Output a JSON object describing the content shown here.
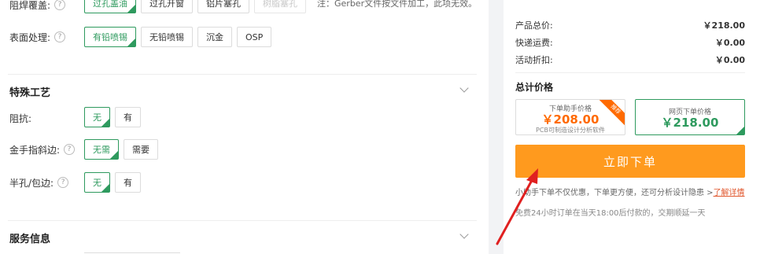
{
  "solder_mask": {
    "label": "阻焊覆盖:",
    "options": [
      "过孔盖油",
      "过孔开窗",
      "铝片塞孔",
      "树脂塞孔"
    ],
    "note": "注：Gerber文件按文件加工，此项无效。"
  },
  "surface": {
    "label": "表面处理:",
    "options": [
      "有铅喷锡",
      "无铅喷锡",
      "沉金",
      "OSP"
    ]
  },
  "special": {
    "title": "特殊工艺",
    "impedance": {
      "label": "阻抗:",
      "options": [
        "无",
        "有"
      ]
    },
    "gold_finger": {
      "label": "金手指斜边:",
      "options": [
        "无需",
        "需要"
      ]
    },
    "half_hole": {
      "label": "半孔/包边:",
      "options": [
        "无",
        "有"
      ]
    }
  },
  "service": {
    "title": "服务信息"
  },
  "prices": [
    {
      "label": "产品总价:",
      "value": "￥218.00"
    },
    {
      "label": "快递运费:",
      "value": "￥0.00"
    },
    {
      "label": "活动折扣:",
      "value": "￥0.00"
    }
  ],
  "total": {
    "title": "总计价格",
    "card1": {
      "title": "下单助手价格",
      "amount": "￥208.00",
      "sub": "PCB可制造设计分析软件",
      "ribbon": "推荐",
      "color": "#ff6a00"
    },
    "card2": {
      "title": "网页下单价格",
      "amount": "￥218.00",
      "color": "#2e9a5e"
    }
  },
  "order_button": "立即下单",
  "hint1": "小助手下单不仅优惠，下单更方便，还可分析设计隐患 >",
  "hint1_link": "了解详情",
  "hint2": "免费24小时订单在当天18:00后付款的，交期顺延一天",
  "colors": {
    "accent_green": "#2e9a5e",
    "order_orange": "#ff9a1e",
    "arrow_red": "#e02020"
  },
  "icons": {
    "help": "?"
  }
}
